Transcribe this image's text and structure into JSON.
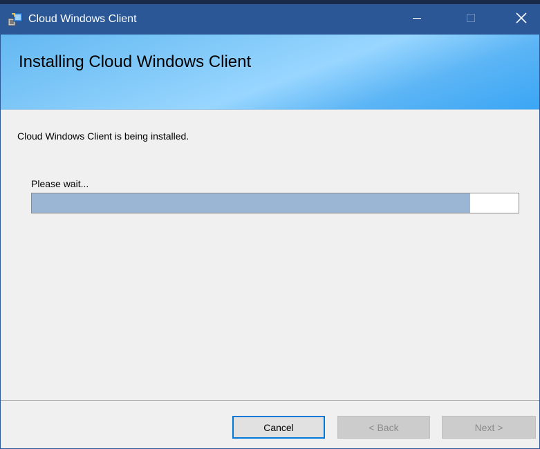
{
  "window": {
    "title": "Cloud Windows Client",
    "title_icon": "installer-icon",
    "controls": {
      "minimize_icon": "minimize-icon",
      "maximize_icon": "maximize-icon",
      "close_icon": "close-icon"
    },
    "titlebar_color": "#2b5797"
  },
  "banner": {
    "title": "Installing Cloud Windows Client"
  },
  "body": {
    "status_text": "Cloud Windows Client is being installed.",
    "wait_text": "Please wait...",
    "progress_fraction": 0.9
  },
  "buttons": {
    "cancel_label": "Cancel",
    "back_label": "< Back",
    "next_label": "Next >"
  },
  "colors": {
    "accent": "#0078d7",
    "progress_fill": "#9bb6d4"
  }
}
